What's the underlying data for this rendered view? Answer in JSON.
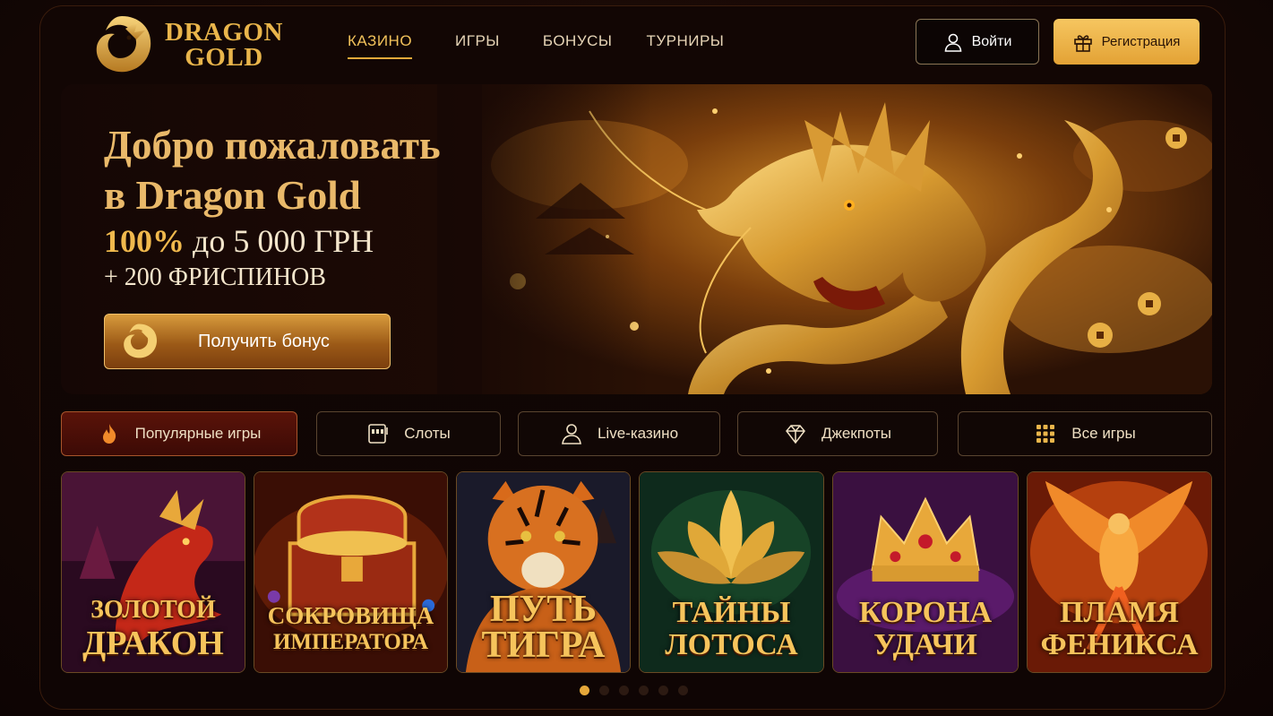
{
  "brand": {
    "line1": "DRAGON",
    "line2": "GOLD",
    "accent": "#e9b54b"
  },
  "nav": {
    "items": [
      {
        "label": "КАЗИНО",
        "active": true
      },
      {
        "label": "ИГРЫ",
        "active": false
      },
      {
        "label": "БОНУСЫ",
        "active": false
      },
      {
        "label": "ТУРНИРЫ",
        "active": false
      }
    ]
  },
  "header": {
    "login_label": "Войти",
    "register_label": "Регистрация",
    "login_icon": "user-icon",
    "register_icon": "gift-icon"
  },
  "hero": {
    "title_line1": "Добро пожаловать",
    "title_line2": "в Dragon Gold",
    "bonus_percent": "100%",
    "bonus_amount": " до 5 000 ГРН",
    "bonus_sub": "+ 200 ФРИСПИНОВ",
    "cta_label": "Получить бонус"
  },
  "categories": [
    {
      "label": "Популярные игры",
      "icon": "flame-icon",
      "active": true
    },
    {
      "label": "Слоты",
      "icon": "slot-machine-icon",
      "active": false
    },
    {
      "label": "Live-казино",
      "icon": "dealer-icon",
      "active": false
    },
    {
      "label": "Джекпоты",
      "icon": "diamond-icon",
      "active": false
    },
    {
      "label": "Все игры",
      "icon": "grid-icon",
      "active": false
    }
  ],
  "games": [
    {
      "line1": "ЗОЛОТОЙ",
      "line2": "ДРАКОН",
      "theme": "#5a1a3a"
    },
    {
      "line1": "СОКРОВИЩА",
      "line2": "ИМПЕРАТОРА",
      "theme": "#4a1205"
    },
    {
      "line1": "ПУТЬ",
      "line2": "ТИГРА",
      "theme": "#1a1c2a"
    },
    {
      "line1": "ТАЙНЫ",
      "line2": "ЛОТОСА",
      "theme": "#0e2a1c"
    },
    {
      "line1": "КОРОНА",
      "line2": "УДАЧИ",
      "theme": "#3a1040"
    },
    {
      "line1": "ПЛАМЯ",
      "line2": "ФЕНИКСА",
      "theme": "#6a1a06"
    }
  ],
  "pagination": {
    "total": 6,
    "current": 1
  }
}
